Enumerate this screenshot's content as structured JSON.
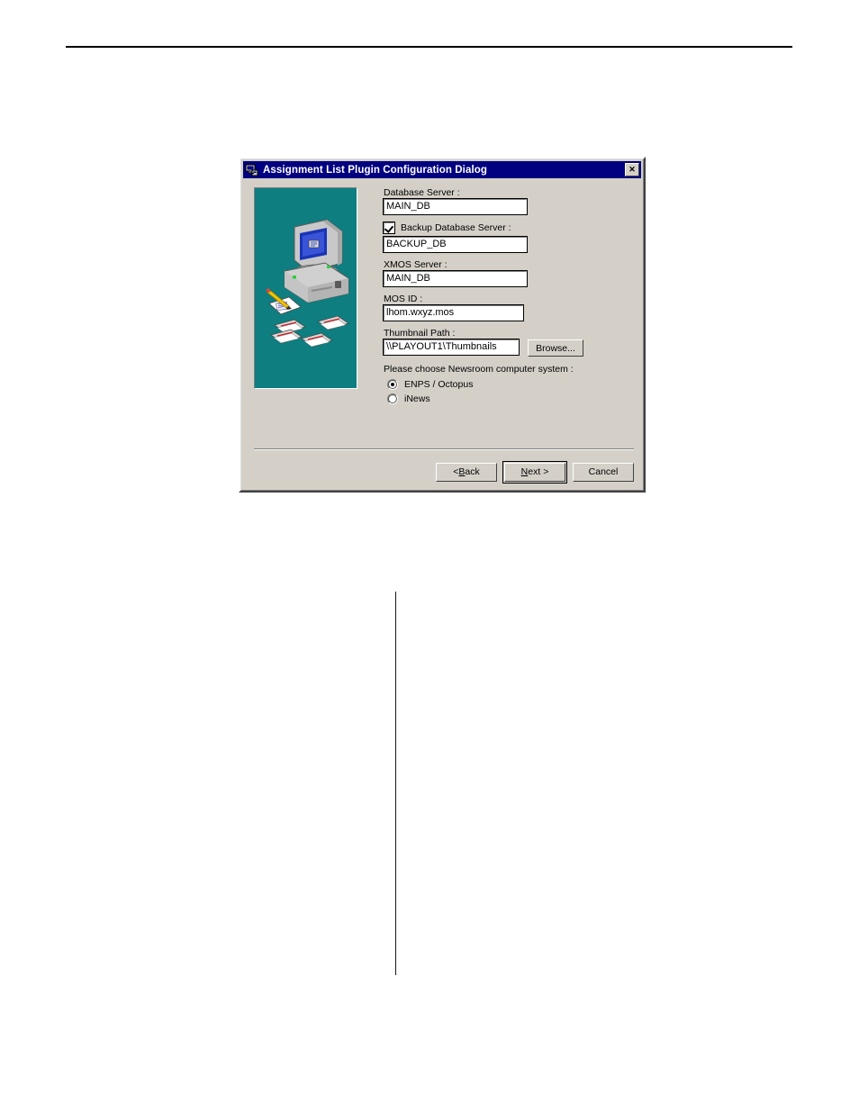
{
  "page": {
    "header_rule": true
  },
  "dialog": {
    "title": "Assignment List Plugin Configuration Dialog",
    "titlebar_icon": "plugin-window-icon",
    "close_label": "✕",
    "illustration": {
      "name": "computer-and-documents-illustration",
      "background_color": "#0e7e80"
    },
    "fields": {
      "database_server": {
        "label": "Database Server :",
        "value": "MAIN_DB",
        "placeholder": ""
      },
      "backup_database_server": {
        "label": "Backup Database Server :",
        "checked": true,
        "value": "BACKUP_DB",
        "placeholder": ""
      },
      "xmos_server": {
        "label": "XMOS Server :",
        "value": "MAIN_DB",
        "placeholder": ""
      },
      "mos_id": {
        "label": "MOS ID :",
        "value": "lhom.wxyz.mos",
        "placeholder": ""
      },
      "thumbnail_path": {
        "label": "Thumbnail Path :",
        "value": "\\\\PLAYOUT1\\Thumbnails",
        "placeholder": "",
        "browse_label": "Browse..."
      }
    },
    "newsroom_group": {
      "label": "Please choose Newsroom computer system :",
      "options": [
        {
          "label": "ENPS / Octopus",
          "selected": true
        },
        {
          "label": "iNews",
          "selected": false
        }
      ]
    },
    "buttons": {
      "back": {
        "pre": "< ",
        "accel": "B",
        "post": "ack",
        "default": false
      },
      "next": {
        "pre": "",
        "accel": "N",
        "post": "ext >",
        "default": true
      },
      "cancel": {
        "label": "Cancel",
        "default": false
      }
    }
  },
  "table": {
    "columns": [
      "",
      ""
    ],
    "rows": [
      {
        "left": "",
        "right": ""
      },
      {
        "left": "",
        "right": ""
      },
      {
        "left": "",
        "right": ""
      },
      {
        "left": "",
        "right": ""
      },
      {
        "left": "",
        "right": ""
      },
      {
        "left": "",
        "right": ""
      },
      {
        "left": "",
        "right": ""
      }
    ]
  }
}
